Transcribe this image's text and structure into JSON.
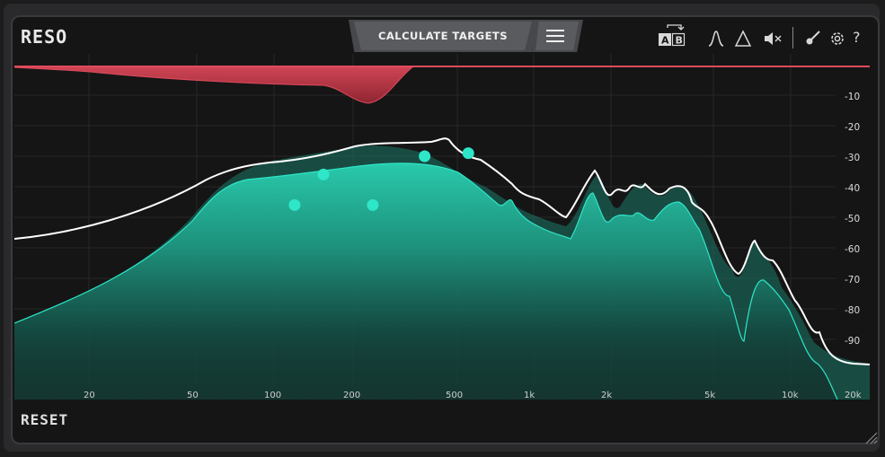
{
  "app": {
    "title": "RESO",
    "reset_label": "RESET"
  },
  "toolbar": {
    "calculate_label": "CALCULATE TARGETS",
    "ab_top": "A",
    "ab_bottom": "B",
    "help_label": "?",
    "icons": [
      "ab-compare-icon",
      "peak-filter-icon",
      "triangle-filter-icon",
      "mute-speaker-icon",
      "brush-icon",
      "gear-icon",
      "help-icon",
      "menu-icon"
    ]
  },
  "colors": {
    "accent": "#2ee6c8",
    "reduction": "#c43a4a",
    "curve": "#ffffff",
    "background": "#151515"
  },
  "graph": {
    "db_labels": [
      "-10",
      "-20",
      "-30",
      "-40",
      "-50",
      "-60",
      "-70",
      "-80",
      "-90"
    ],
    "hz_labels": [
      "20",
      "50",
      "100",
      "200",
      "500",
      "1k",
      "2k",
      "5k",
      "10k",
      "20k"
    ],
    "target_nodes": [
      {
        "freq": 120,
        "db": -46
      },
      {
        "freq": 155,
        "db": -36
      },
      {
        "freq": 240,
        "db": -46
      },
      {
        "freq": 380,
        "db": -30
      },
      {
        "freq": 560,
        "db": -29
      }
    ]
  }
}
